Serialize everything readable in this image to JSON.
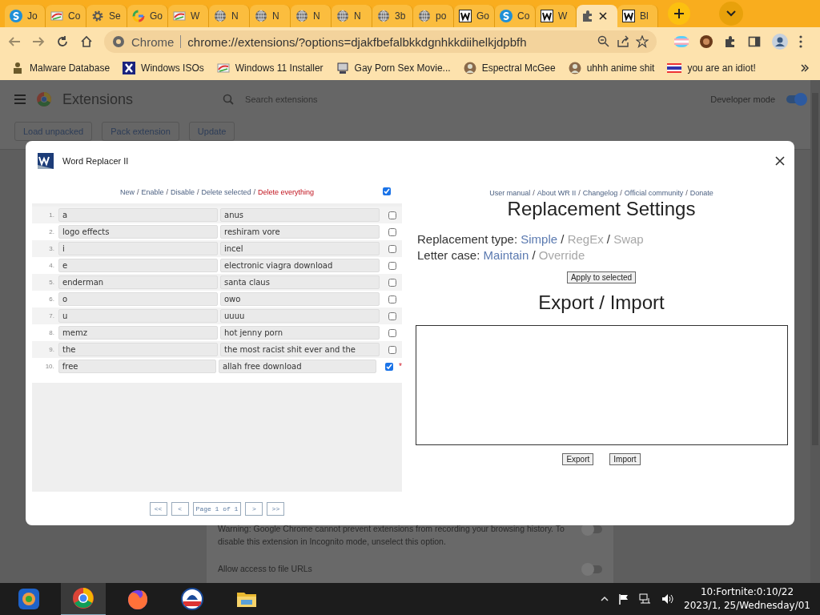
{
  "browser": {
    "tabs": [
      {
        "kind": "s-logo",
        "label": "Jo",
        "selected": false
      },
      {
        "kind": "paint",
        "label": "Co",
        "selected": false
      },
      {
        "kind": "gear",
        "label": "Se",
        "selected": false
      },
      {
        "kind": "google",
        "label": "Go",
        "selected": false
      },
      {
        "kind": "paint",
        "label": "W",
        "selected": false
      },
      {
        "kind": "globe",
        "label": "N",
        "selected": false
      },
      {
        "kind": "globe",
        "label": "N",
        "selected": false
      },
      {
        "kind": "globe",
        "label": "N",
        "selected": false
      },
      {
        "kind": "globe",
        "label": "N",
        "selected": false
      },
      {
        "kind": "globe",
        "label": "3b",
        "selected": false
      },
      {
        "kind": "globe",
        "label": "po",
        "selected": false
      },
      {
        "kind": "w-logo",
        "label": "Go",
        "selected": false
      },
      {
        "kind": "s-logo",
        "label": "Co",
        "selected": false
      },
      {
        "kind": "w-logo",
        "label": "W",
        "selected": false
      },
      {
        "kind": "puzzle",
        "selected": true
      },
      {
        "kind": "w-logo",
        "label": "Bl",
        "selected": false
      }
    ],
    "address": {
      "chip": "Chrome",
      "url": "chrome://extensions/?options=djakfbefalbkkdgnhkkdiihelkjdpbfh"
    },
    "bookmarks": [
      {
        "kind": "figure",
        "label": "Malware Database"
      },
      {
        "kind": "x-logo",
        "label": "Windows ISOs"
      },
      {
        "kind": "paint",
        "label": "Windows 11 Installer"
      },
      {
        "kind": "computer",
        "label": "Gay Porn Sex Movie..."
      },
      {
        "kind": "face",
        "label": "Espectral McGee"
      },
      {
        "kind": "face",
        "label": "uhhh anime shit"
      },
      {
        "kind": "flag",
        "label": "you are an idiot!"
      }
    ]
  },
  "extensions_page": {
    "title": "Extensions",
    "search": {
      "placeholder": "Search extensions"
    },
    "developer_mode": {
      "label": "Developer mode",
      "on": true
    },
    "buttons": [
      "Load unpacked",
      "Pack extension",
      "Update"
    ],
    "card": {
      "warning": "Warning: Google Chrome cannot prevent extensions from recording your browsing history. To disable this extension in Incognito mode, unselect this option.",
      "warning_on": false,
      "file_urls": "Allow access to file URLs",
      "file_urls_on": false
    }
  },
  "dialog": {
    "title": "Word Replacer II",
    "separator": "/",
    "actions": [
      {
        "label": "New",
        "kind": "normal"
      },
      {
        "label": "Enable",
        "kind": "normal"
      },
      {
        "label": "Disable",
        "kind": "normal"
      },
      {
        "label": "Delete selected",
        "kind": "normal"
      },
      {
        "label": "Delete everything",
        "kind": "danger"
      }
    ],
    "select_all": true,
    "rows": [
      {
        "number": "1.",
        "find": "a",
        "replace": "anus",
        "checked": false
      },
      {
        "number": "2.",
        "find": "logo effects",
        "replace": "reshiram vore",
        "checked": false
      },
      {
        "number": "3.",
        "find": "i",
        "replace": "incel",
        "checked": false
      },
      {
        "number": "4.",
        "find": "e",
        "replace": "electronic viagra download",
        "checked": false
      },
      {
        "number": "5.",
        "find": "enderman",
        "replace": "santa claus",
        "checked": false
      },
      {
        "number": "6.",
        "find": "o",
        "replace": "owo",
        "checked": false
      },
      {
        "number": "7.",
        "find": "u",
        "replace": "uuuu",
        "checked": false
      },
      {
        "number": "8.",
        "find": "memz",
        "replace": "hot jenny porn",
        "checked": false
      },
      {
        "number": "9.",
        "find": "the",
        "replace": "the most racist shit ever and the",
        "checked": false
      },
      {
        "number": "10.",
        "find": "free",
        "replace": "allah free download",
        "checked": true,
        "marker": "*"
      }
    ],
    "pager": {
      "first": "<<",
      "prev": "<",
      "page": "Page 1 of 1",
      "next": ">",
      "last": ">>"
    },
    "links": [
      "User manual",
      "About WR II",
      "Changelog",
      "Official community",
      "Donate"
    ],
    "settings_heading": "Replacement Settings",
    "replacement_type": {
      "label": "Replacement type:",
      "options": [
        {
          "label": "Simple",
          "selected": true
        },
        {
          "label": "RegEx",
          "selected": false
        },
        {
          "label": "Swap",
          "selected": false
        }
      ]
    },
    "letter_case": {
      "label": "Letter case:",
      "options": [
        {
          "label": "Maintain",
          "selected": true
        },
        {
          "label": "Override",
          "selected": false
        }
      ]
    },
    "apply_button": "Apply to selected",
    "export_heading": "Export / Import",
    "export_buttons": [
      "Export",
      "Import"
    ]
  },
  "taskbar": {
    "clock_time": "10:Fortnite:0:10/22",
    "clock_date": "2023/1, 25/Wednesday/01"
  }
}
